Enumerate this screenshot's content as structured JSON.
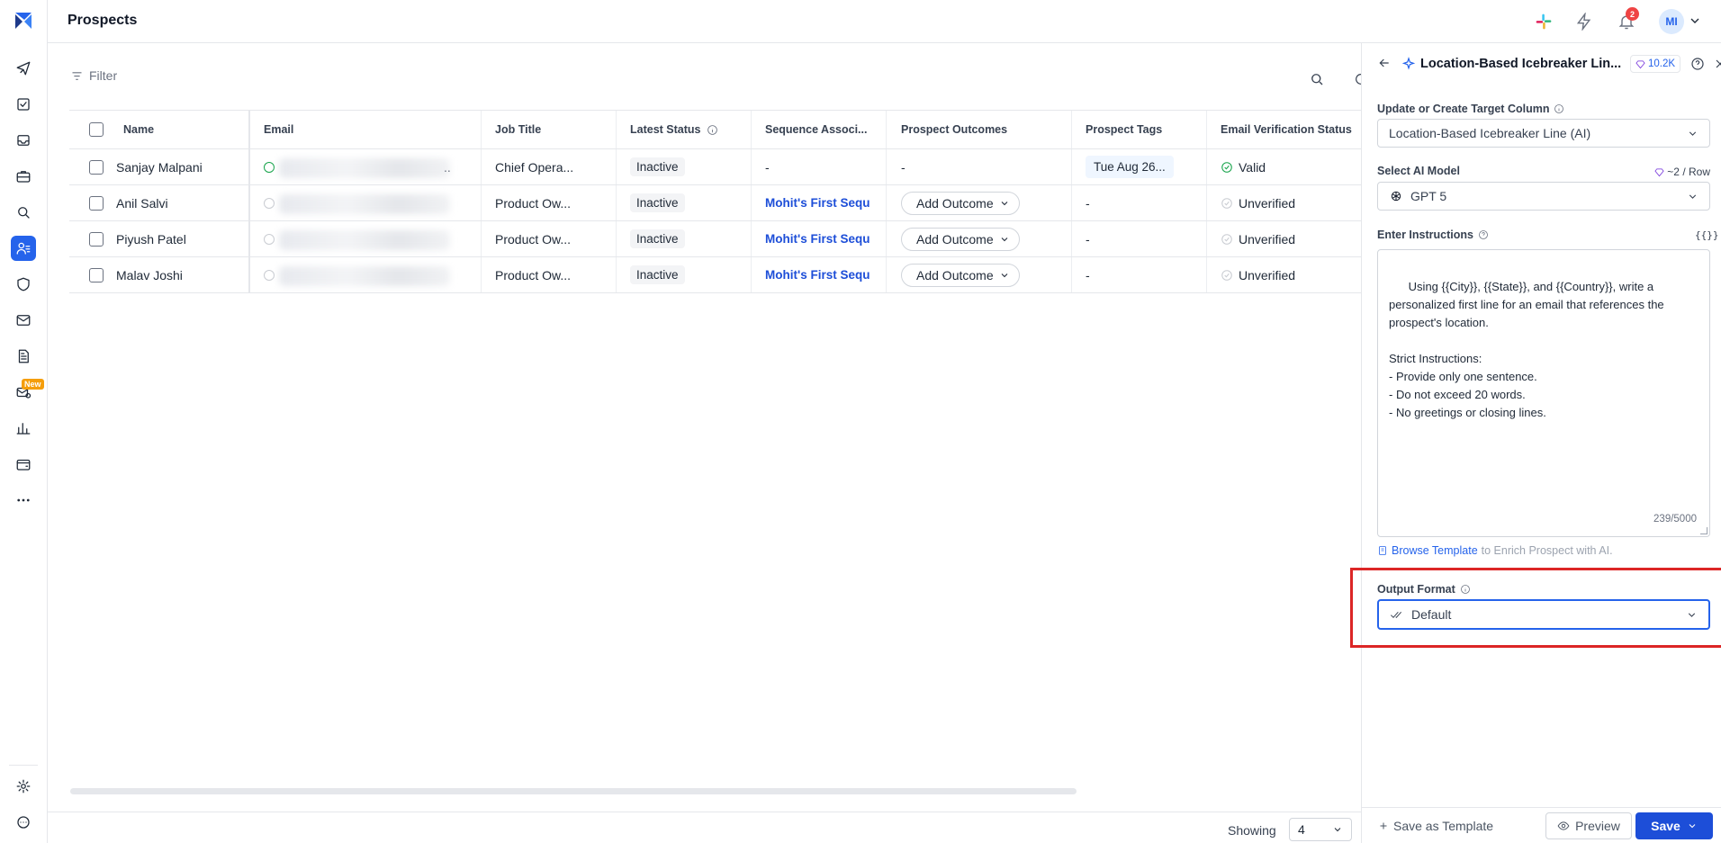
{
  "page": {
    "title": "Prospects",
    "notification_count": "2",
    "avatar_initials": "MI",
    "rail_new_badge": "New"
  },
  "toolbar": {
    "filter_label": "Filter"
  },
  "table": {
    "columns": [
      "Name",
      "Email",
      "Job Title",
      "Latest Status",
      "Sequence Associ...",
      "Prospect Outcomes",
      "Prospect Tags",
      "Email Verification Status"
    ],
    "rows": [
      {
        "name": "Sanjay Malpani",
        "email_tail": "..",
        "job": "Chief Opera...",
        "status": "Inactive",
        "sequence": "-",
        "outcome": "-",
        "tags": "Tue Aug 26...",
        "verification": "Valid"
      },
      {
        "name": "Anil Salvi",
        "email_tail": "",
        "job": "Product Ow...",
        "status": "Inactive",
        "sequence": "Mohit's First Sequ",
        "outcome": "Add Outcome",
        "tags": "-",
        "verification": "Unverified"
      },
      {
        "name": "Piyush Patel",
        "email_tail": "",
        "job": "Product Ow...",
        "status": "Inactive",
        "sequence": "Mohit's First Sequ",
        "outcome": "Add Outcome",
        "tags": "-",
        "verification": "Unverified"
      },
      {
        "name": "Malav Joshi",
        "email_tail": "",
        "job": "Product Ow...",
        "status": "Inactive",
        "sequence": "Mohit's First Sequ",
        "outcome": "Add Outcome",
        "tags": "-",
        "verification": "Unverified"
      }
    ]
  },
  "footer": {
    "showing_label": "Showing",
    "page_size": "4"
  },
  "panel": {
    "title": "Location-Based Icebreaker Lin...",
    "credits": "10.2K",
    "target_column_label": "Update or Create Target Column",
    "target_column_value": "Location-Based Icebreaker Line (AI)",
    "model_label": "Select AI Model",
    "model_cost": "~2 / Row",
    "model_value": "GPT 5",
    "instructions_label": "Enter Instructions",
    "variables_icon_text": "{{}}",
    "instructions_text": "Using {{City}}, {{State}}, and {{Country}}, write a personalized first line for an email that references the prospect's location.\n\nStrict Instructions:\n- Provide only one sentence.\n- Do not exceed 20 words.\n- No greetings or closing lines.",
    "char_counter": "239/5000",
    "browse_link": "Browse Template",
    "browse_suffix": "to Enrich Prospect with AI.",
    "output_format_label": "Output Format",
    "output_format_value": "Default",
    "save_template_label": "Save as Template",
    "preview_label": "Preview",
    "save_label": "Save"
  },
  "colors": {
    "accent": "#2563eb",
    "primary_button": "#1d4ed8",
    "highlight": "#dc2626",
    "valid": "#16a34a",
    "badge": "#ef4444",
    "new_badge": "#f59e0b"
  }
}
